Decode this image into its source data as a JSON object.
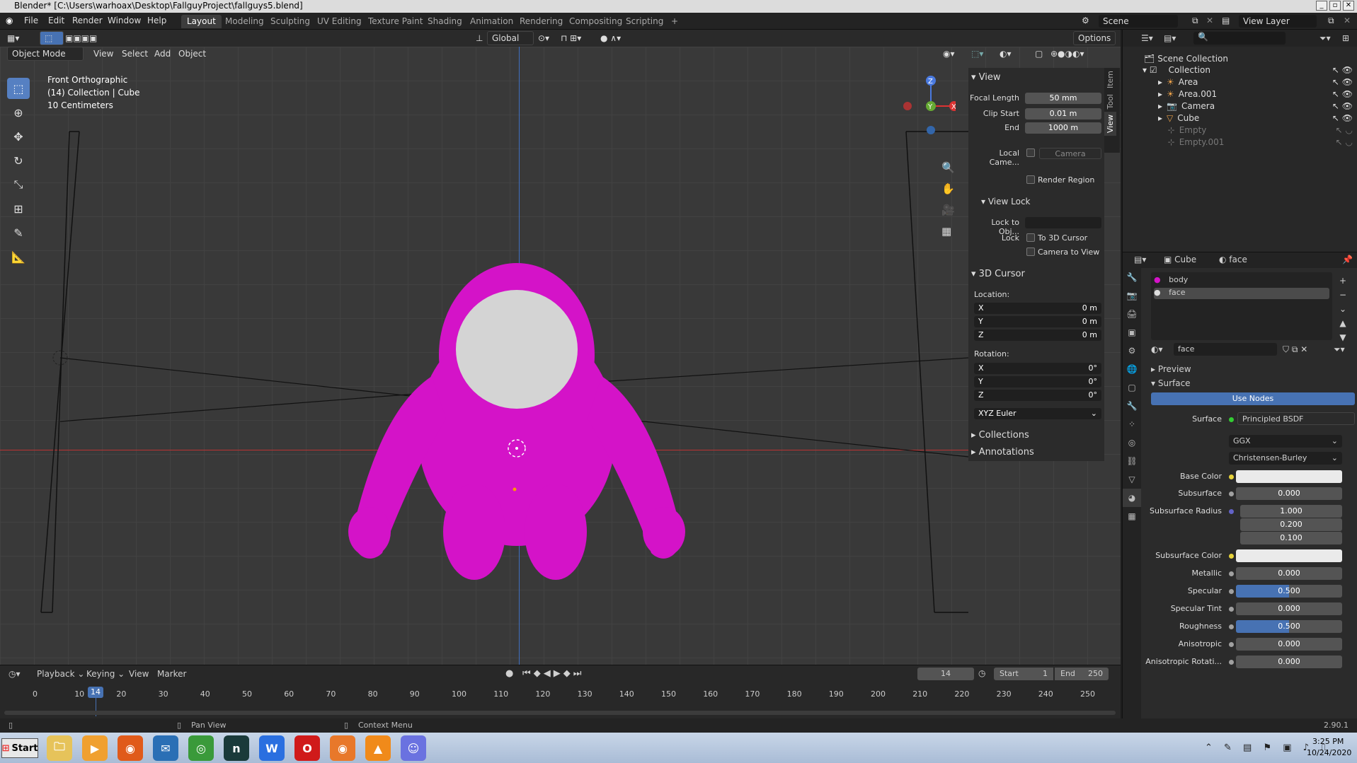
{
  "window": {
    "title": "Blender* [C:\\Users\\warhoax\\Desktop\\FallguyProject\\fallguys5.blend]"
  },
  "menu": [
    "File",
    "Edit",
    "Render",
    "Window",
    "Help"
  ],
  "workspaces": [
    "Layout",
    "Modeling",
    "Sculpting",
    "UV Editing",
    "Texture Paint",
    "Shading",
    "Animation",
    "Rendering",
    "Compositing",
    "Scripting"
  ],
  "active_workspace": "Layout",
  "scene": {
    "name": "Scene",
    "view_layer": "View Layer"
  },
  "header": {
    "orientation": "Global",
    "options": "Options"
  },
  "viewport": {
    "mode": "Object Mode",
    "menus": [
      "View",
      "Select",
      "Add",
      "Object"
    ],
    "info": [
      "Front Orthographic",
      "(14) Collection | Cube",
      "10 Centimeters"
    ],
    "object_colors": {
      "body": "#d413c8",
      "face": "#d4d4d4",
      "background": "#393939"
    }
  },
  "npanel": {
    "tabs": [
      "Item",
      "Tool",
      "View"
    ],
    "view": {
      "title": "View",
      "focal_length_label": "Focal Length",
      "focal_length": "50 mm",
      "clip_start_label": "Clip Start",
      "clip_start": "0.01 m",
      "end_label": "End",
      "end": "1000 m",
      "local_camera_label": "Local Came...",
      "local_camera": "Camera",
      "render_region": "Render Region"
    },
    "view_lock": {
      "title": "View Lock",
      "lock_to_obj_label": "Lock to Obj...",
      "lock_label": "Lock",
      "to_3d_cursor": "To 3D Cursor",
      "camera_to_view": "Camera to View"
    },
    "cursor": {
      "title": "3D Cursor",
      "location_label": "Location:",
      "location": [
        {
          "axis": "X",
          "value": "0 m"
        },
        {
          "axis": "Y",
          "value": "0 m"
        },
        {
          "axis": "Z",
          "value": "0 m"
        }
      ],
      "rotation_label": "Rotation:",
      "rotation": [
        {
          "axis": "X",
          "value": "0°"
        },
        {
          "axis": "Y",
          "value": "0°"
        },
        {
          "axis": "Z",
          "value": "0°"
        }
      ],
      "rotation_mode": "XYZ Euler"
    },
    "collections": "Collections",
    "annotations": "Annotations"
  },
  "outliner": {
    "root": "Scene Collection",
    "collection": "Collection",
    "items": [
      {
        "name": "Area",
        "dim": false
      },
      {
        "name": "Area.001",
        "dim": false
      },
      {
        "name": "Camera",
        "dim": false
      },
      {
        "name": "Cube",
        "dim": false
      },
      {
        "name": "Empty",
        "dim": true
      },
      {
        "name": "Empty.001",
        "dim": true
      }
    ]
  },
  "properties": {
    "object": "Cube",
    "material": "face",
    "slots": [
      "body",
      "face"
    ],
    "material_name": "face",
    "preview": "Preview",
    "surface": "Surface",
    "use_nodes": "Use Nodes",
    "surface_label": "Surface",
    "surface_shader": "Principled BSDF",
    "distribution": "GGX",
    "subsurface_method": "Christensen-Burley",
    "fields": [
      {
        "label": "Base Color",
        "value": "",
        "kind": "white"
      },
      {
        "label": "Subsurface",
        "value": "0.000",
        "kind": "num"
      },
      {
        "label": "Subsurface Radius",
        "value": "1.000",
        "kind": "num"
      },
      {
        "label": "",
        "value": "0.200",
        "kind": "num"
      },
      {
        "label": "",
        "value": "0.100",
        "kind": "num"
      },
      {
        "label": "Subsurface Color",
        "value": "",
        "kind": "white"
      },
      {
        "label": "Metallic",
        "value": "0.000",
        "kind": "num"
      },
      {
        "label": "Specular",
        "value": "0.500",
        "kind": "blue"
      },
      {
        "label": "Specular Tint",
        "value": "0.000",
        "kind": "num"
      },
      {
        "label": "Roughness",
        "value": "0.500",
        "kind": "blue"
      },
      {
        "label": "Anisotropic",
        "value": "0.000",
        "kind": "num"
      },
      {
        "label": "Anisotropic Rotati...",
        "value": "0.000",
        "kind": "num"
      }
    ]
  },
  "timeline": {
    "menus": [
      "Playback",
      "Keying",
      "View",
      "Marker"
    ],
    "current_frame": "14",
    "start_label": "Start",
    "start": "1",
    "end_label": "End",
    "end": "250",
    "ticks": [
      "0",
      "10",
      "20",
      "30",
      "40",
      "50",
      "60",
      "70",
      "80",
      "90",
      "100",
      "110",
      "120",
      "130",
      "140",
      "150",
      "160",
      "170",
      "180",
      "190",
      "200",
      "210",
      "220",
      "230",
      "240",
      "250"
    ]
  },
  "statusbar": {
    "pan_view": "Pan View",
    "context_menu": "Context Menu",
    "version": "2.90.1"
  },
  "taskbar": {
    "start": "Start",
    "time": "3:25 PM",
    "date": "10/24/2020",
    "apps": [
      "Explorer",
      "Media Player",
      "Firefox",
      "Thunderbird",
      "Chrome",
      "Nox",
      "WPS",
      "Opera",
      "Blender",
      "VLC",
      "Discord"
    ]
  }
}
